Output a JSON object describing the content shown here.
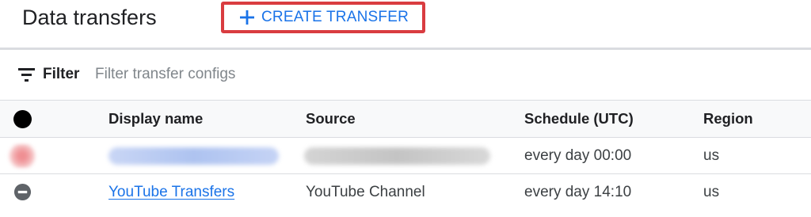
{
  "header": {
    "title": "Data transfers",
    "create_button": {
      "icon": "plus-icon",
      "label": "CREATE TRANSFER"
    },
    "highlight_color": "#d93c40",
    "accent_color": "#1a73e8"
  },
  "filter": {
    "icon": "filter-list-icon",
    "label": "Filter",
    "placeholder": "Filter transfer configs"
  },
  "table": {
    "columns": [
      "",
      "Display name",
      "Source",
      "Schedule (UTC)",
      "Region"
    ],
    "status_header_icon": "status-filled-circle-icon",
    "rows": [
      {
        "status": "error",
        "status_icon": "error-status-icon",
        "display_name": "",
        "source": "",
        "schedule": "every day 00:00",
        "region": "us",
        "redacted": true
      },
      {
        "status": "paused",
        "status_icon": "paused-status-icon",
        "display_name": "YouTube Transfers",
        "source": "YouTube Channel",
        "schedule": "every day 14:10",
        "region": "us",
        "redacted": false
      }
    ]
  }
}
